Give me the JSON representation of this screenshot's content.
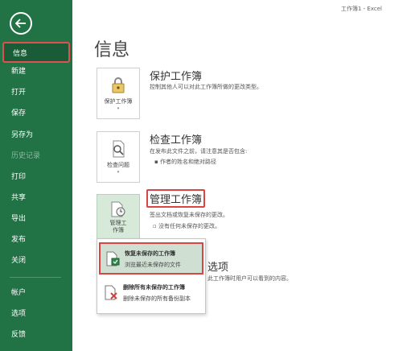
{
  "window": {
    "title": "工作簿1 - Excel"
  },
  "nav": {
    "items": [
      {
        "label": "信息",
        "state": "active"
      },
      {
        "label": "新建",
        "state": "normal"
      },
      {
        "label": "打开",
        "state": "normal"
      },
      {
        "label": "保存",
        "state": "normal"
      },
      {
        "label": "另存为",
        "state": "normal"
      },
      {
        "label": "历史记录",
        "state": "disabled"
      },
      {
        "label": "打印",
        "state": "normal"
      },
      {
        "label": "共享",
        "state": "normal"
      },
      {
        "label": "导出",
        "state": "normal"
      },
      {
        "label": "发布",
        "state": "normal"
      },
      {
        "label": "关闭",
        "state": "normal"
      },
      {
        "label": "帐户",
        "state": "normal"
      },
      {
        "label": "选项",
        "state": "normal"
      },
      {
        "label": "反馈",
        "state": "normal"
      }
    ]
  },
  "page": {
    "title": "信息"
  },
  "sections": {
    "protect": {
      "tile_label": "保护工作簿",
      "title": "保护工作簿",
      "desc": "控制其他人可以对此工作簿所做的更改类型。"
    },
    "inspect": {
      "tile_label": "检查问题",
      "title": "检查工作簿",
      "desc": "在发布此文件之前，请注意其是否包含:",
      "bullet": "作者的姓名和绝对路径"
    },
    "manage": {
      "tile_label_1": "管理工",
      "tile_label_2": "作簿",
      "title": "管理工作簿",
      "desc": "签出文档或恢复未保存的更改。",
      "bullet": "没有任何未保存的更改。"
    },
    "browser": {
      "title_tail": "选项",
      "desc_tail": "此工作簿时用户可以看到的内容。"
    }
  },
  "menu": {
    "items": [
      {
        "title": "恢复未保存的工作簿",
        "desc": "浏览最近未保存的文件"
      },
      {
        "title": "删除所有未保存的工作簿",
        "desc": "删除未保存的所有备份副本"
      }
    ]
  },
  "colors": {
    "accent": "#217346",
    "highlight": "#d94444",
    "hover": "#cfe0d3"
  }
}
